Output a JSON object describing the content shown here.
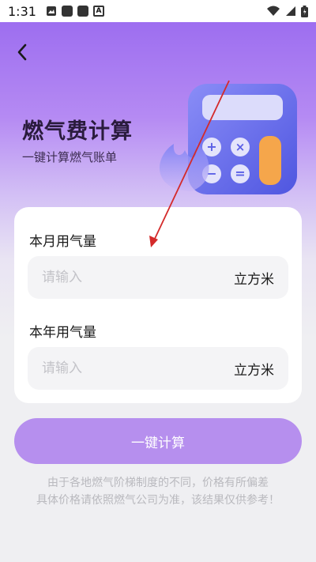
{
  "status_bar": {
    "time": "1:31",
    "icons": [
      "image-icon",
      "app-icon",
      "app-icon",
      "a-icon",
      "wifi-icon",
      "signal-icon",
      "battery-icon"
    ]
  },
  "header": {
    "back_icon": "chevron-left-icon",
    "title": "燃气费计算",
    "subtitle": "一键计算燃气账单"
  },
  "form": {
    "monthly": {
      "label": "本月用气量",
      "placeholder": "请输入",
      "unit": "立方米"
    },
    "yearly": {
      "label": "本年用气量",
      "placeholder": "请输入",
      "unit": "立方米"
    }
  },
  "actions": {
    "calculate_label": "一键计算"
  },
  "disclaimer": {
    "line1": "由于各地燃气阶梯制度的不同，价格有所偏差",
    "line2": "具体价格请依照燃气公司为准，该结果仅供参考！"
  },
  "colors": {
    "accent": "#b68fee",
    "hero_top": "#9d6ef0",
    "background": "#efeff2",
    "annotation_arrow": "#d42a2a"
  }
}
